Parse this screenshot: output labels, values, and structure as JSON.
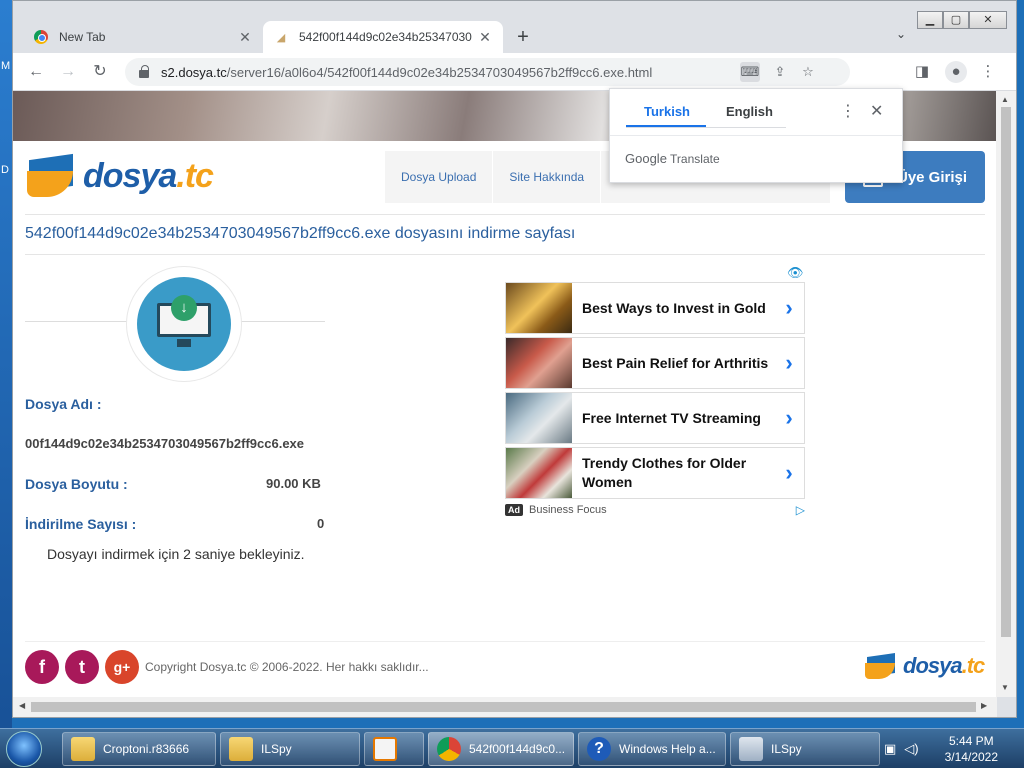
{
  "browser": {
    "tabs": [
      {
        "title": "New Tab",
        "active": false
      },
      {
        "title": "542f00f144d9c02e34b25347030",
        "active": true
      }
    ],
    "url_host": "s2.dosya.tc",
    "url_path": "/server16/a0l6o4/542f00f144d9c02e34b2534703049567b2ff9cc6.exe.html",
    "new_tab_symbol": "+",
    "tab_search_symbol": "⌄",
    "window_controls": [
      "minimize",
      "maximize",
      "close"
    ]
  },
  "site": {
    "logo_main": "dosya",
    "logo_suffix": ".tc",
    "menu": [
      "Dosya Upload",
      "Site Hakkında"
    ],
    "login_label": "Üye Girişi",
    "page_title": "542f00f144d9c02e34b2534703049567b2ff9cc6.exe dosyasını indirme sayfası",
    "file_name_label": "Dosya Adı :",
    "file_name_value": "00f144d9c02e34b2534703049567b2ff9cc6.exe",
    "file_size_label": "Dosya Boyutu :",
    "file_size_value": "90.00 KB",
    "download_count_label": "İndirilme Sayısı :",
    "download_count_value": "0",
    "wait_message": "Dosyayı indirmek için 2 saniye bekleyiniz.",
    "copyright": "Copyright Dosya.tc © 2006-2022. Her hakkı saklıdır...",
    "social": [
      {
        "icon": "facebook-icon",
        "glyph": "f",
        "color": "#a8195a"
      },
      {
        "icon": "twitter-icon",
        "glyph": "t",
        "color": "#a8195a"
      },
      {
        "icon": "google-plus-icon",
        "glyph": "g+",
        "color": "#d9452b"
      }
    ]
  },
  "ads": {
    "items": [
      {
        "text": "Best Ways to Invest in Gold"
      },
      {
        "text": "Best Pain Relief for Arthritis"
      },
      {
        "text": "Free Internet TV Streaming"
      },
      {
        "text": "Trendy Clothes for Older Women"
      }
    ],
    "badge": "Ad",
    "sponsor": "Business Focus"
  },
  "translate_popup": {
    "tab_active": "Turkish",
    "tab_other": "English",
    "brand_google": "Google",
    "brand_label": "Translate"
  },
  "taskbar": {
    "items": [
      {
        "label": "Croptoni.r83666",
        "icon": "folder-icon"
      },
      {
        "label": "ILSpy",
        "icon": "folder-icon"
      },
      {
        "label": "",
        "icon": "media-player-icon"
      },
      {
        "label": "542f00f144d9c0...",
        "icon": "chrome-icon"
      },
      {
        "label": "Windows Help a...",
        "icon": "help-icon"
      },
      {
        "label": "ILSpy",
        "icon": "ilspy-icon"
      }
    ],
    "time": "5:44 PM",
    "date": "3/14/2022"
  },
  "colors": {
    "brand_blue": "#1e5ea8",
    "brand_orange": "#f4a21b",
    "link_blue": "#2a5f9e",
    "ad_chevron": "#1a73e8"
  }
}
